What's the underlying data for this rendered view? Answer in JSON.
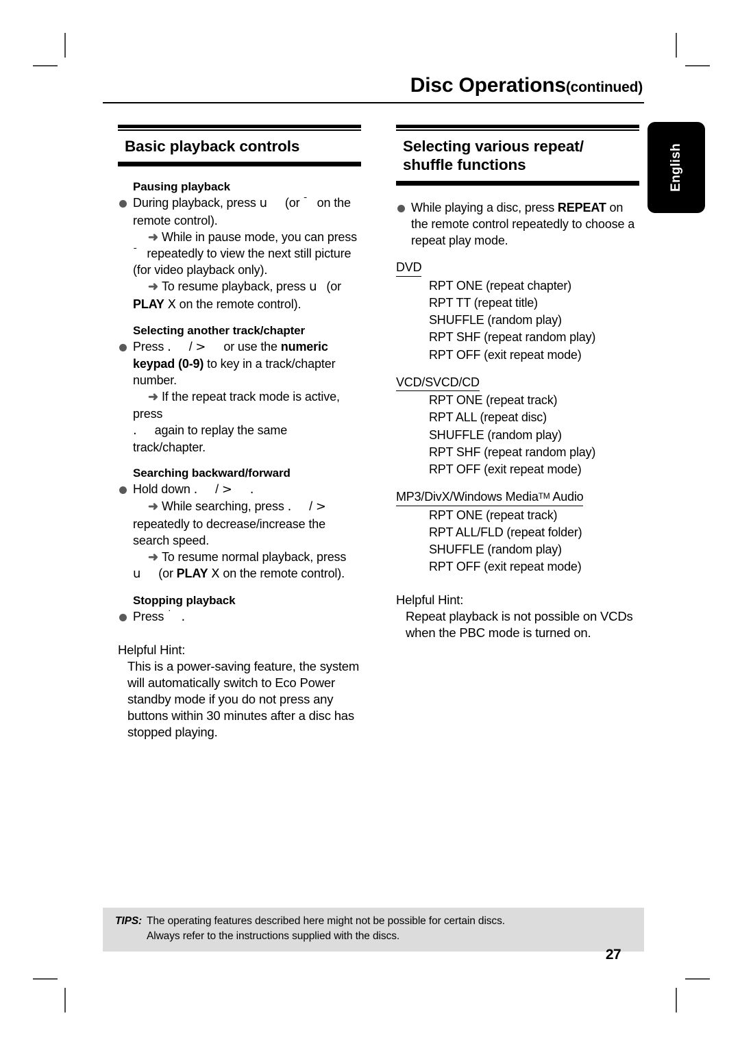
{
  "header": {
    "title": "Disc Operations",
    "continued": "(continued)"
  },
  "language_tab": {
    "label": "English"
  },
  "left_column": {
    "section_title": "Basic playback controls",
    "blocks": [
      {
        "sub_head": "Pausing playback",
        "bullet_lines": [
          "During playback, press u",
          "(or",
          "¯",
          "on the remote control)."
        ],
        "arrows": [
          "While in pause mode, you can press ¯ repeatedly to view the next still picture (for video playback only).",
          "To resume playback, press u (or PLAY X on the remote control)."
        ]
      },
      {
        "sub_head": "Selecting another track/chapter",
        "bullet_lines": [
          "Press . / > or use the numeric keypad (0-9) to key in a track/chapter number."
        ],
        "arrows": [
          "If the repeat track mode is active, press . again to replay the same track/chapter."
        ]
      },
      {
        "sub_head": "Searching backward/forward",
        "bullet_lines": [
          "Hold down . / > ."
        ],
        "arrows": [
          "While searching, press . / > repeatedly to decrease/increase the search speed.",
          "To resume normal playback, press u (or PLAY X on the remote control)."
        ]
      },
      {
        "sub_head": "Stopping playback",
        "bullet_lines": [
          "Press ˙ ."
        ],
        "arrows": []
      }
    ],
    "hint": {
      "label": "Helpful Hint:",
      "text": "This is a power-saving feature, the system will automatically switch to Eco Power standby mode if you do not press any buttons within 30 minutes after a disc has stopped playing."
    }
  },
  "right_column": {
    "section_title_line1": "Selecting various repeat/",
    "section_title_line2": "shuffle functions",
    "intro_bullet": "While playing a disc, press REPEAT on the remote control repeatedly to choose a repeat play mode.",
    "intro_bold_word": "REPEAT",
    "disc_groups": [
      {
        "type": "DVD",
        "modes": [
          "RPT ONE (repeat chapter)",
          "RPT TT (repeat title)",
          "SHUFFLE (random play)",
          "RPT SHF (repeat random play)",
          "RPT OFF (exit repeat mode)"
        ]
      },
      {
        "type": "VCD/SVCD/CD",
        "modes": [
          "RPT ONE (repeat track)",
          "RPT ALL (repeat disc)",
          "SHUFFLE (random play)",
          "RPT SHF (repeat random play)",
          "RPT OFF (exit repeat mode)"
        ]
      },
      {
        "type": "MP3/DivX/Windows Media",
        "type_tm": "TM",
        "type_suffix": " Audio",
        "modes": [
          "RPT ONE (repeat track)",
          "RPT ALL/FLD (repeat folder)",
          "SHUFFLE (random play)",
          "RPT OFF (exit repeat mode)"
        ]
      }
    ],
    "hint": {
      "label": "Helpful Hint:",
      "text": "Repeat playback is not possible on VCDs when the PBC mode is turned on."
    }
  },
  "tips": {
    "label": "TIPS:",
    "line1": "The operating features described here might not be possible for certain discs.",
    "line2": "Always refer to the instructions supplied with the discs."
  },
  "page_number": "27",
  "colors": {
    "bullet": "#595959",
    "tips_background": "#dcdcdc",
    "tab_background": "#000000"
  }
}
